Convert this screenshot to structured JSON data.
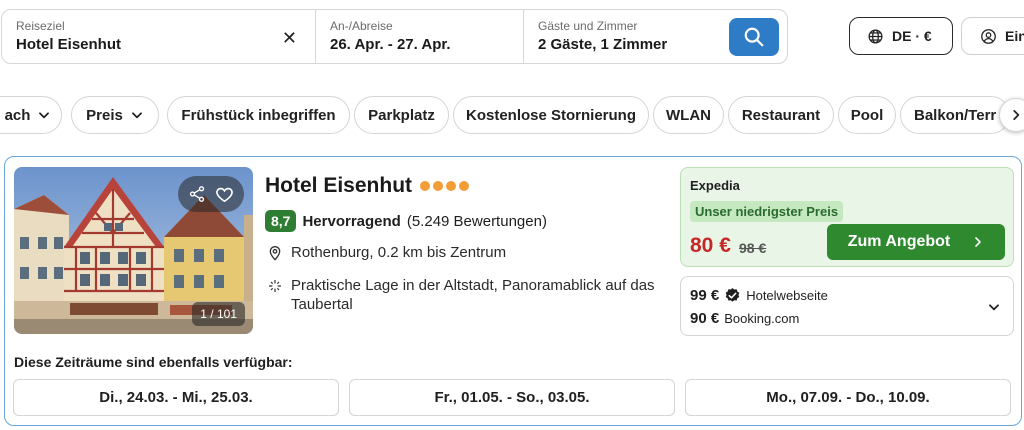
{
  "search": {
    "destination_label": "Reiseziel",
    "destination_value": "Hotel Eisenhut",
    "dates_label": "An-/Abreise",
    "dates_value": "26. Apr. - 27. Apr.",
    "guests_label": "Gäste und Zimmer",
    "guests_value": "2 Gäste, 1 Zimmer",
    "clear_glyph": "✕"
  },
  "header": {
    "locale_label": "DE · €",
    "login_label": "Ein"
  },
  "filters": [
    {
      "label": "ach",
      "dropdown": true
    },
    {
      "label": "Preis",
      "dropdown": true
    },
    {
      "label": "Frühstück inbegriffen",
      "dropdown": false
    },
    {
      "label": "Parkplatz",
      "dropdown": false
    },
    {
      "label": "Kostenlose Stornierung",
      "dropdown": false
    },
    {
      "label": "WLAN",
      "dropdown": false
    },
    {
      "label": "Restaurant",
      "dropdown": false
    },
    {
      "label": "Pool",
      "dropdown": false
    },
    {
      "label": "Balkon/Terr",
      "dropdown": false
    }
  ],
  "hotel": {
    "name": "Hotel Eisenhut",
    "stars": 4,
    "rating_score": "8,7",
    "rating_word": "Hervorragend",
    "rating_count": "(5.249 Bewertungen)",
    "location": "Rothenburg, 0.2 km bis Zentrum",
    "feature": "Praktische Lage in der Altstadt, Panoramablick auf das Taubertal",
    "photo_counter": "1 / 101"
  },
  "deal": {
    "provider": "Expedia",
    "badge": "Unser niedrigster Preis",
    "price": "80 €",
    "old_price": "98 €",
    "button_label": "Zum Angebot"
  },
  "other_offers": [
    {
      "price": "99 €",
      "name": "Hotelwebseite",
      "verified": true
    },
    {
      "price": "90 €",
      "name": "Booking.com",
      "verified": false
    }
  ],
  "alternatives": {
    "title": "Diese Zeiträume sind ebenfalls verfügbar:",
    "dates": [
      "Di., 24.03. - Mi., 25.03.",
      "Fr., 01.05. - So., 03.05.",
      "Mo., 07.09. - Do., 10.09."
    ]
  },
  "colors": {
    "accent_blue": "#2e7bc6",
    "rating_green": "#2e7d32",
    "deal_green": "#2f8a2f",
    "price_red": "#c62828",
    "star_orange": "#f29d38"
  }
}
